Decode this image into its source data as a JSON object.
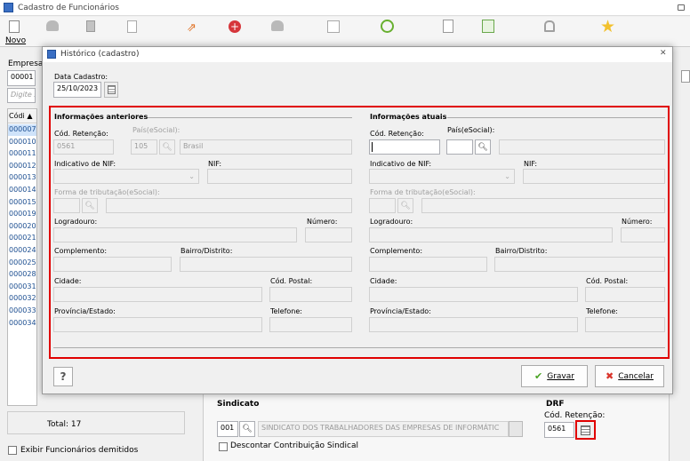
{
  "app": {
    "title": "Cadastro de Funcionários",
    "novo_label": "Novo",
    "empresa_label": "Empresa",
    "empresa_code": "00001",
    "search_placeholder": "Digite sua",
    "col_code": "Códi",
    "total": "Total: 17",
    "show_dismissed": "Exibir Funcionários demitidos",
    "codes": [
      "000007",
      "000010",
      "000011",
      "000012",
      "000013",
      "000014",
      "000015",
      "000019",
      "000020",
      "000021",
      "000024",
      "000025",
      "000028",
      "000031",
      "000032",
      "000033",
      "000034"
    ]
  },
  "bg": {
    "sindicato_label": "Sindicato",
    "sindicato_code": "001",
    "sindicato_name": "SINDICATO DOS TRABALHADORES DAS EMPRESAS DE INFORMÁTIC",
    "descontar_label": "Descontar Contribuição Sindical",
    "drf_label": "DRF",
    "cod_ret_label": "Cód. Retenção:",
    "cod_ret_value": "0561"
  },
  "dialog": {
    "title": "Histórico (cadastro)",
    "data_cadastro_label": "Data Cadastro:",
    "data_cadastro": "25/10/2023",
    "prev": {
      "heading": "Informações anteriores",
      "cod_ret": "0561",
      "pais_code": "105",
      "pais_name": "Brasil"
    },
    "curr": {
      "heading": "Informações atuais"
    },
    "labels": {
      "cod_ret": "Cód. Retenção:",
      "pais": "País(eSocial):",
      "nif_ind": "Indicativo de NIF:",
      "nif": "NIF:",
      "forma": "Forma de tributação(eSocial):",
      "logradouro": "Logradouro:",
      "numero": "Número:",
      "complemento": "Complemento:",
      "bairro": "Bairro/Distrito:",
      "cidade": "Cidade:",
      "cod_postal": "Cód. Postal:",
      "provincia": "Província/Estado:",
      "telefone": "Telefone:"
    },
    "help_label": "?",
    "gravar_label": "Gravar",
    "cancelar_label": "Cancelar"
  },
  "colors": {
    "accent_red": "#e00000",
    "check_green": "#4aa324",
    "cancel_red": "#d9342b"
  }
}
